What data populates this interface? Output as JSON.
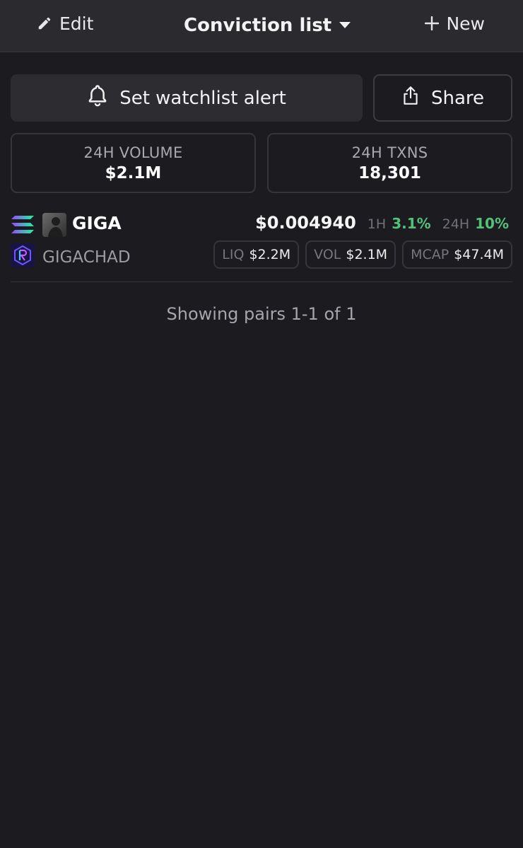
{
  "topbar": {
    "edit_label": "Edit",
    "title": "Conviction list",
    "new_label": "New"
  },
  "actions": {
    "alert_label": "Set watchlist alert",
    "share_label": "Share"
  },
  "stats": {
    "volume_label": "24H VOLUME",
    "volume_value": "$2.1M",
    "txns_label": "24H TXNS",
    "txns_value": "18,301"
  },
  "pairs": [
    {
      "symbol": "GIGA",
      "name": "GIGACHAD",
      "price": "$0.004940",
      "change_1h_label": "1H",
      "change_1h": "3.1%",
      "change_24h_label": "24H",
      "change_24h": "10%",
      "liq_label": "LIQ",
      "liq": "$2.2M",
      "vol_label": "VOL",
      "vol": "$2.1M",
      "mcap_label": "MCAP",
      "mcap": "$47.4M",
      "chain_icon": "solana-icon",
      "dex_icon": "raydium-icon"
    }
  ],
  "footer": {
    "pagination": "Showing pairs 1-1 of 1"
  },
  "colors": {
    "background": "#1b1b20",
    "topbar": "#2a2a2f",
    "positive": "#52c27a",
    "muted": "#9c9ca2"
  }
}
